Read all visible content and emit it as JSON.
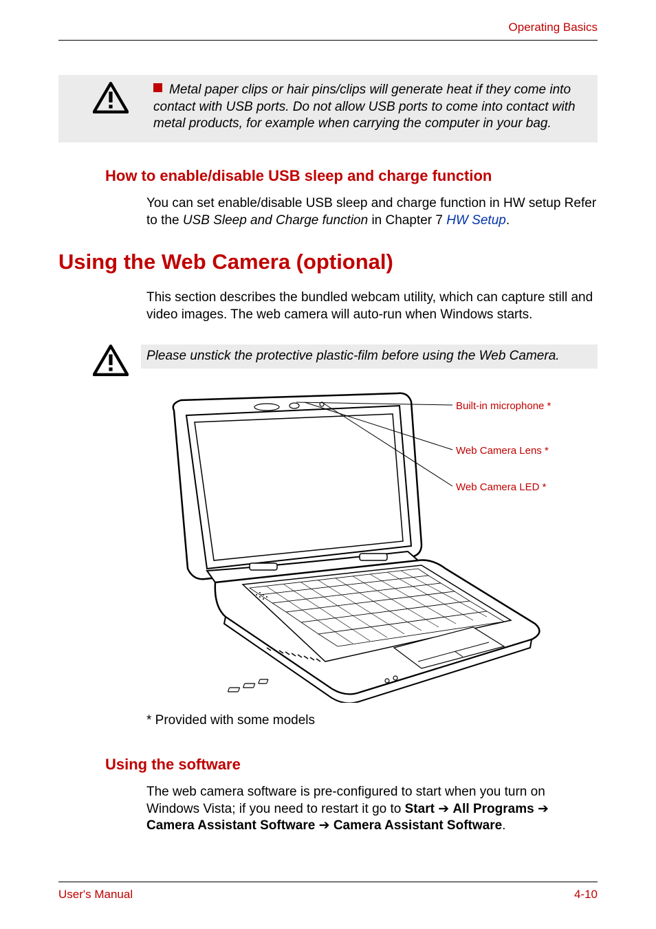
{
  "header": {
    "section_title": "Operating Basics"
  },
  "warning1": {
    "text": "Metal paper clips or hair pins/clips will generate heat if they come into contact with USB ports. Do not allow USB ports to come into contact with metal products, for example when carrying the computer in your bag."
  },
  "section_usb": {
    "heading": "How to enable/disable USB sleep and charge function",
    "p1_a": "You can set enable/disable USB sleep and charge function in HW setup Refer to the ",
    "p1_ital": "USB Sleep and Charge function",
    "p1_b": " in Chapter 7 ",
    "p1_link": "HW Setup",
    "p1_c": "."
  },
  "section_webcam": {
    "h1": "Using the Web Camera (optional)",
    "intro": "This section describes the bundled webcam utility, which can capture still and video images. The web camera will auto-run when Windows starts.",
    "warning": "Please unstick the protective plastic-film before using the Web Camera."
  },
  "diagram": {
    "callouts": {
      "mic": "Built-in microphone *",
      "lens": "Web Camera Lens *",
      "led": "Web Camera LED *"
    },
    "footnote": "* Provided with some models"
  },
  "section_software": {
    "heading": "Using the software",
    "p1_a": "The web camera software is pre-configured to start when you turn on Windows Vista; if you need to restart it go to ",
    "b1": "Start",
    "arrow": " ➔ ",
    "b2": "All Programs",
    "b3": "Camera Assistant Software",
    "b4": "Camera Assistant Software",
    "p1_end": "."
  },
  "footer": {
    "left": "User's Manual",
    "right": "4-10"
  }
}
